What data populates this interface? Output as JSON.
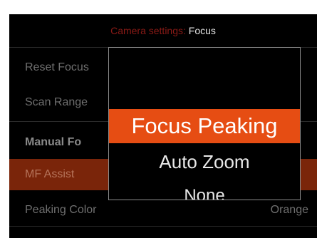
{
  "header": {
    "label": "Camera settings:",
    "value": "Focus"
  },
  "menu": {
    "items": [
      {
        "label": "Reset Focus"
      },
      {
        "label": "Scan Range"
      }
    ],
    "section": "Manual Fo",
    "mf_assist": {
      "label": "MF Assist"
    },
    "peaking": {
      "label": "Peaking Color",
      "value": "Orange"
    }
  },
  "popup": {
    "options": [
      "Focus Peaking",
      "Auto Zoom",
      "None"
    ],
    "selected": "Focus Peaking"
  },
  "colors": {
    "accent": "#e64d13",
    "highlight_row": "#7a250a",
    "header_label": "#8a1a16"
  }
}
